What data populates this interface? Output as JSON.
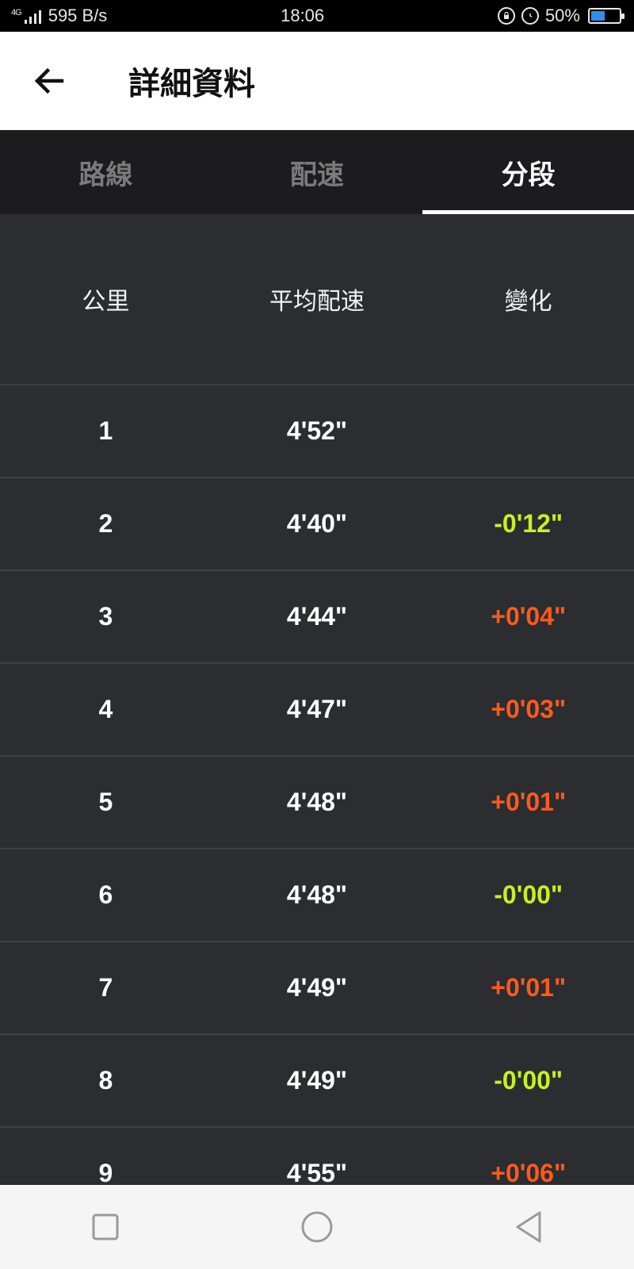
{
  "status_bar": {
    "network": "4G",
    "speed": "595 B/s",
    "time": "18:06",
    "battery_percent": "50%",
    "battery_level": 0.5,
    "icons": [
      "signal-icon",
      "rotation-lock-icon",
      "alarm-icon",
      "battery-icon"
    ]
  },
  "app_bar": {
    "back_icon": "arrow-left-icon",
    "title": "詳細資料"
  },
  "tabs": [
    {
      "label": "路線",
      "active": false
    },
    {
      "label": "配速",
      "active": false
    },
    {
      "label": "分段",
      "active": true
    }
  ],
  "table": {
    "headers": [
      "公里",
      "平均配速",
      "變化"
    ],
    "rows": [
      {
        "km": "1",
        "pace": "4'52\"",
        "change": "",
        "type": ""
      },
      {
        "km": "2",
        "pace": "4'40\"",
        "change": "-0'12\"",
        "type": "neg"
      },
      {
        "km": "3",
        "pace": "4'44\"",
        "change": "+0'04\"",
        "type": "pos"
      },
      {
        "km": "4",
        "pace": "4'47\"",
        "change": "+0'03\"",
        "type": "pos"
      },
      {
        "km": "5",
        "pace": "4'48\"",
        "change": "+0'01\"",
        "type": "pos"
      },
      {
        "km": "6",
        "pace": "4'48\"",
        "change": "-0'00\"",
        "type": "neg"
      },
      {
        "km": "7",
        "pace": "4'49\"",
        "change": "+0'01\"",
        "type": "pos"
      },
      {
        "km": "8",
        "pace": "4'49\"",
        "change": "-0'00\"",
        "type": "neg"
      },
      {
        "km": "9",
        "pace": "4'55\"",
        "change": "+0'06\"",
        "type": "pos"
      }
    ]
  },
  "colors": {
    "negative_change": "#c6f21f",
    "positive_change": "#ff5a1c",
    "background": "#2b2d30",
    "tab_bar": "#1c1c1e"
  },
  "nav_bar": {
    "buttons": [
      "recent-apps-icon",
      "home-icon",
      "back-triangle-icon"
    ]
  }
}
